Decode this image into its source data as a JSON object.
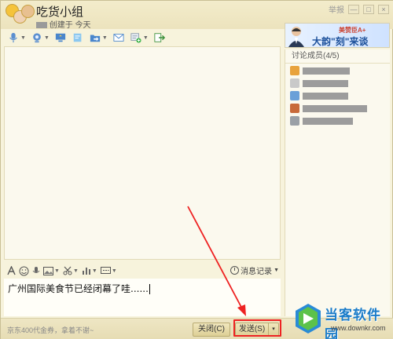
{
  "window": {
    "group_name": "吃货小组",
    "created_suffix": "创建于 今天",
    "report_label": "举报",
    "controls": [
      "—",
      "□",
      "×"
    ]
  },
  "toolbar": {
    "icons": [
      "voice-icon",
      "video-icon",
      "share-screen-icon",
      "note-icon",
      "folder-icon",
      "email-icon",
      "app-icon",
      "exit-icon"
    ]
  },
  "ad": {
    "brand": "美赞臣A+",
    "slogan": "大韵\"刻\"来谈"
  },
  "members": {
    "title": "讨论成员(4/5)",
    "items": [
      {
        "avatar_color": "#e8a23c",
        "name_width": 60
      },
      {
        "avatar_color": "#c9c9c9",
        "name_width": 58
      },
      {
        "avatar_color": "#6aa0d8",
        "name_width": 58
      },
      {
        "avatar_color": "#c86a3a",
        "name_width": 82
      },
      {
        "avatar_color": "#9aa0a6",
        "name_width": 64
      }
    ]
  },
  "input_toolbar": {
    "history_label": "消息记录"
  },
  "input": {
    "text": "广州国际美食节已经闭幕了哇......"
  },
  "bottom": {
    "promo": "京东400代金券，拿着不谢~",
    "close_label": "关闭(C)",
    "send_label": "发送(S)",
    "send_dropdown": "▾"
  },
  "watermark": {
    "title": "当客软件园",
    "url": "www.downkr.com"
  },
  "colors": {
    "accent": "#1b7cc9",
    "highlight": "#e22222"
  }
}
